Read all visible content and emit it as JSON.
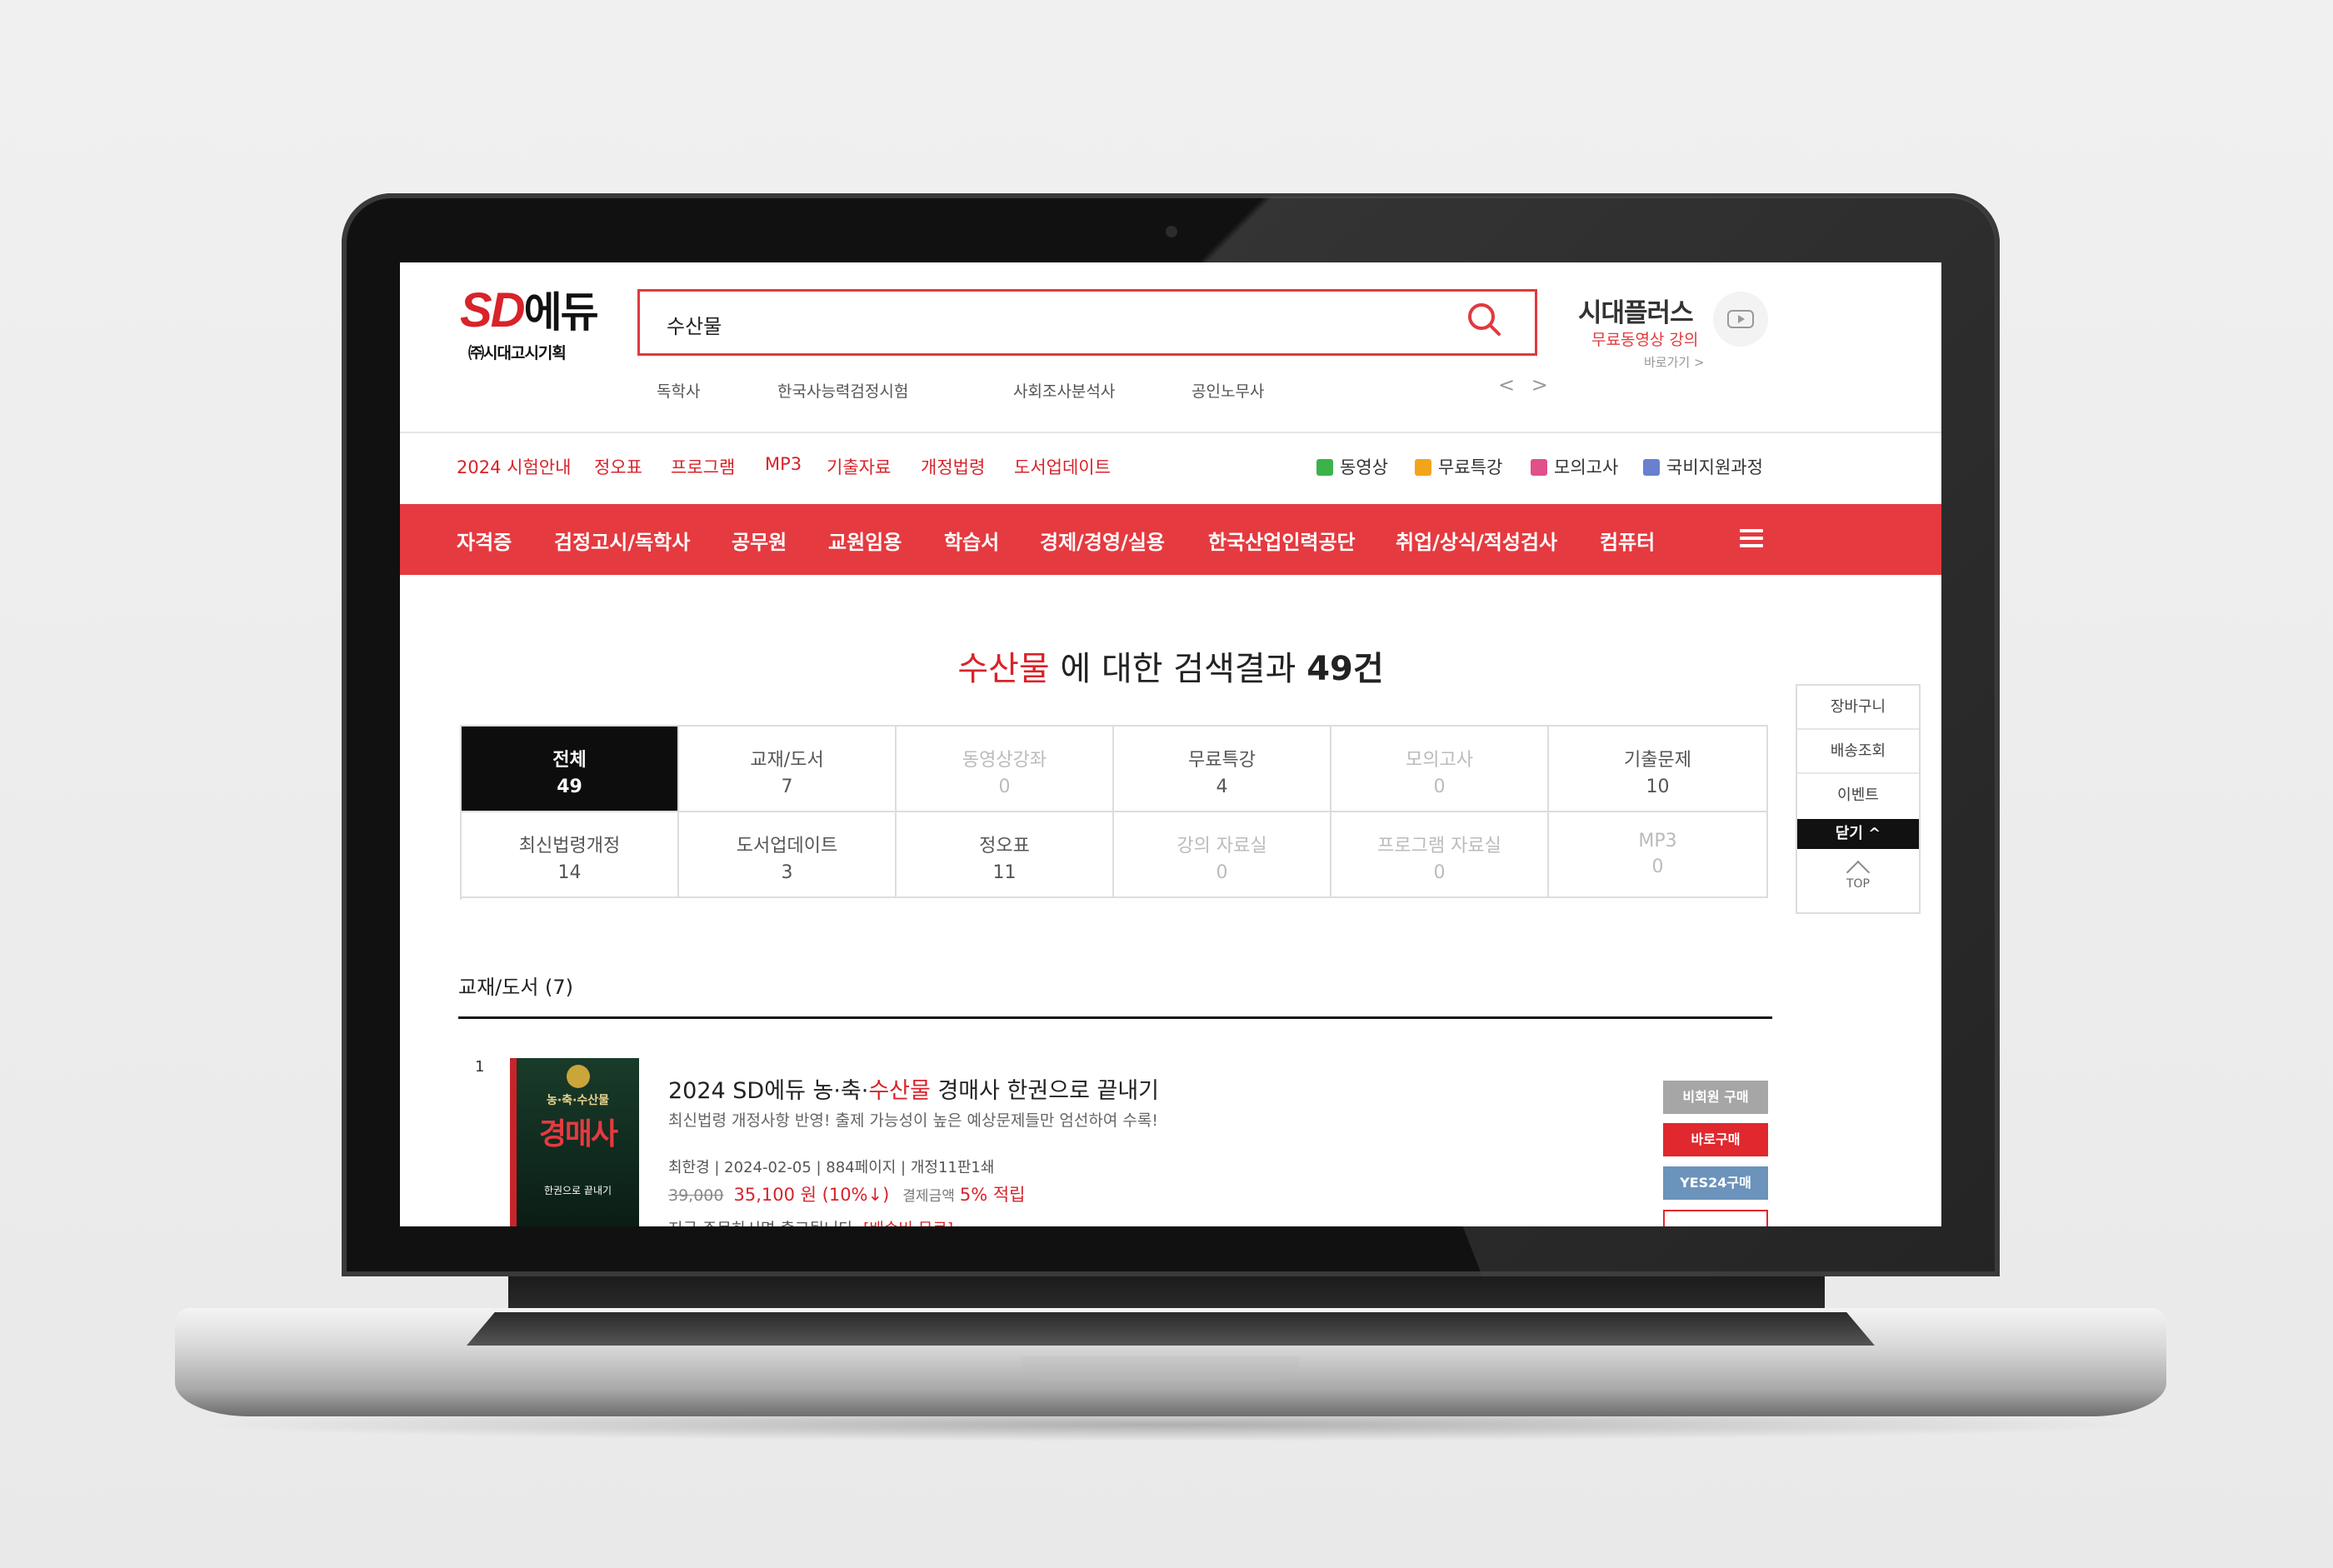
{
  "logo": {
    "main": "SD",
    "main2": "에듀",
    "sub": "㈜시대고시기획"
  },
  "search": {
    "value": "수산물"
  },
  "keywords": [
    "독학사",
    "한국사능력검정시험",
    "사회조사분석사",
    "공인노무사"
  ],
  "keyword_nav": "< >",
  "plus": {
    "title": "시대플러스",
    "subtitle": "무료동영상 강의",
    "link": "바로가기 >"
  },
  "subnav": [
    "2024 시험안내",
    "정오표",
    "프로그램",
    "MP3",
    "기출자료",
    "개정법령",
    "도서업데이트"
  ],
  "quick_links": [
    {
      "label": "동영상",
      "color": "#3bb34a"
    },
    {
      "label": "무료특강",
      "color": "#f2a51a"
    },
    {
      "label": "모의고사",
      "color": "#e0508a"
    },
    {
      "label": "국비지원과정",
      "color": "#6a7fd0"
    }
  ],
  "main_nav": [
    "자격증",
    "검정고시/독학사",
    "공무원",
    "교원임용",
    "학습서",
    "경제/경영/실용",
    "한국산업인력공단",
    "취업/상식/적성검사",
    "컴퓨터"
  ],
  "result": {
    "keyword": "수산물",
    "text": " 에 대한 검색결과 ",
    "count": "49건"
  },
  "categories": [
    {
      "label": "전체",
      "count": "49"
    },
    {
      "label": "교재/도서",
      "count": "7"
    },
    {
      "label": "동영상강좌",
      "count": "0"
    },
    {
      "label": "무료특강",
      "count": "4"
    },
    {
      "label": "모의고사",
      "count": "0"
    },
    {
      "label": "기출문제",
      "count": "10"
    },
    {
      "label": "최신법령개정",
      "count": "14"
    },
    {
      "label": "도서업데이트",
      "count": "3"
    },
    {
      "label": "정오표",
      "count": "11"
    },
    {
      "label": "강의 자료실",
      "count": "0"
    },
    {
      "label": "프로그램 자료실",
      "count": "0"
    },
    {
      "label": "MP3",
      "count": "0"
    }
  ],
  "section": {
    "title": "교재/도서 (7)"
  },
  "item": {
    "no": "1",
    "title_pre": "2024 SD에듀 농·축·",
    "title_kw": "수산물",
    "title_post": " 경매사 한권으로 끝내기",
    "desc": "최신법령 개정사항 반영! 출제 가능성이 높은 예상문제들만 엄선하여 수록!",
    "meta": "최한경 | 2024-02-05 | 884페이지 | 개정11판1쇄",
    "price_orig": "39,000",
    "price_sale": "35,100 원 (10%↓)",
    "points_label": "결제금액",
    "points": "5% 적립",
    "notice": "지금 주문하시면 출고됩니다.",
    "notice_red": "[배송비 무료]",
    "cover_top": "농·축·수산물",
    "cover_main": "경매사",
    "cover_sub": "한권으로 끝내기"
  },
  "buy_buttons": [
    {
      "label": "비회원 구매",
      "color": "#a6a6a6"
    },
    {
      "label": "바로구매",
      "color": "#e0282e"
    },
    {
      "label": "YES24구매",
      "color": "#6b93bb"
    }
  ],
  "side_menu": {
    "items": [
      "장바구니",
      "배송조회",
      "이벤트"
    ],
    "close": "닫기 ^",
    "top": "TOP"
  }
}
